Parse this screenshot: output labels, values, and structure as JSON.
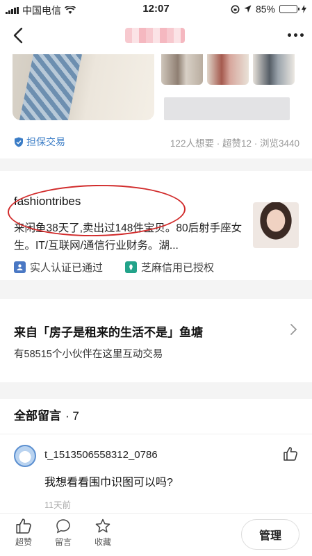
{
  "status_bar": {
    "carrier": "中国电信",
    "time": "12:07",
    "battery": "85%",
    "battery_level": 0.85
  },
  "product": {
    "guarantee_label": "担保交易",
    "stats": "122人想要 · 超赞12 · 浏览3440"
  },
  "seller": {
    "name": "fashiontribes",
    "bio": "来闲鱼38天了,卖出过148件宝贝。80后射手座女生。IT/互联网/通信行业财务。湖...",
    "verified_label": "实人认证已通过",
    "credit_label": "芝麻信用已授权"
  },
  "pond": {
    "title": "来自「房子是租来的生活不是」鱼塘",
    "subtitle": "有58515个小伙伴在这里互动交易"
  },
  "comments": {
    "header": "全部留言",
    "count": "· 7",
    "items": [
      {
        "user": "t_1513506558312_0786",
        "text": "我想看看围巾识图可以吗?",
        "time": "11天前"
      }
    ]
  },
  "bottom_bar": {
    "like_label": "超赞",
    "message_label": "留言",
    "favorite_label": "收藏",
    "manage_label": "管理"
  }
}
